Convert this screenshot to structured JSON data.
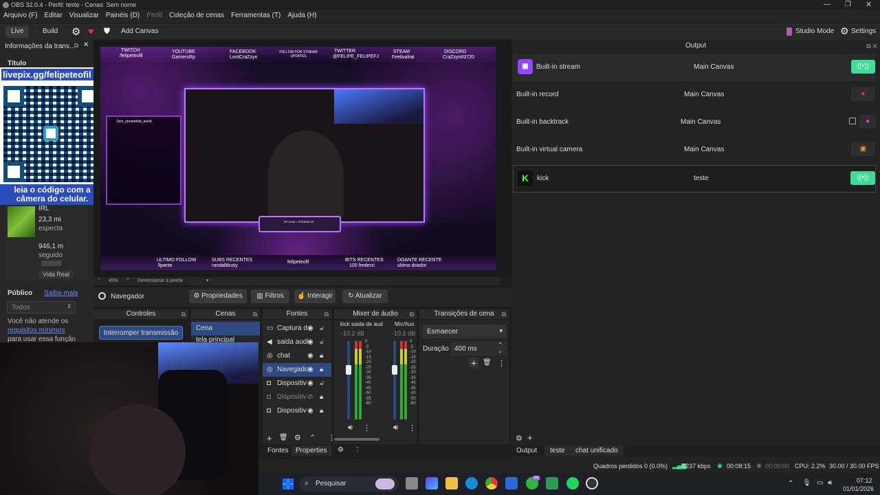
{
  "window": {
    "title": "OBS 32.0.4 - Perfil: teste - Cenas: Sem nome"
  },
  "menu": [
    "Arquivo (F)",
    "Editar",
    "Visualizar",
    "Painéis (D)",
    "Perfil",
    "Coleção de cenas",
    "Ferramentas (T)",
    "Ajuda (H)"
  ],
  "toolbar": {
    "live": "Live",
    "build": "Build",
    "add_canvas": "Add Canvas",
    "studio_mode": "Studio Mode",
    "settings": "Settings"
  },
  "left_dock": {
    "title": "Informações da trans...",
    "titulo": "Título",
    "livepix": "livepix.gg/felipeteofil",
    "qr_caption": "leia o código com a câmera do celular.",
    "category_short": "IRL",
    "viewers": "23,3 mi",
    "viewers_label": "especta",
    "followers": "946,1 m",
    "followers_label": "seguido",
    "vida_real": "Vida Real",
    "publico": "Público",
    "saiba_mais": "Saiba mais",
    "select_value": "Todos",
    "req_text1": "Você não atende os",
    "req_link": "requisitos mínimos",
    "req_text2": "para usar essa função"
  },
  "preview": {
    "zoom": "45%",
    "scale_label": "Dimensionar à janela",
    "overlay_labels": [
      "TWITCH",
      "YOUTUBE",
      "FACEBOOK",
      "TWITTER",
      "STEAM",
      "DISCORD"
    ],
    "overlay_values": [
      "/felipeteofil",
      "GamersRp",
      "LordCraZzyn",
      "@FELIPE_FELIPEFJ",
      "Feelivalrat",
      "CraZzyn#3720"
    ],
    "follow_label": "FOLLOW FOR STREAM UPDATES",
    "bottom_labels": [
      "ULTIMO FOLLOW",
      "SUBS RECENTES",
      "felipeteofil",
      "BITS RECENTES",
      "DOANTE RECENTE"
    ],
    "bottom_values": [
      "llpante",
      "randalldusty",
      "",
      "100   frederzi",
      "ultimo doador"
    ],
    "chat_line": "0cm_streamhab_world",
    "goal_label": "TIP GOAL / STREAM UP"
  },
  "source_toolbar": {
    "name": "Navegador",
    "props": "Propriedades",
    "filters": "Filtros",
    "interact": "Interagir",
    "refresh": "Atualizar"
  },
  "controls": {
    "title": "Controles",
    "stop": "Interromper transmissão"
  },
  "scenes": {
    "title": "Cenas",
    "items": [
      "Cena",
      "tela principal"
    ]
  },
  "sources": {
    "title": "Fontes",
    "items": [
      "Captura d",
      "saida audi",
      "chat",
      "Navegadc",
      "Dispositiv",
      "Dispositiv",
      "Dispositiv"
    ],
    "tab_sources": "Fontes",
    "tab_props": "Properties"
  },
  "mixer": {
    "title": "Mixer de áudio",
    "ch1_name": "kick saida de aud",
    "ch1_db": "-10.2 dB",
    "ch2_name": "Mic/Aux",
    "ch2_db": "-10.1 dB",
    "scale": [
      "0",
      "-5",
      "-10",
      "-15",
      "-20",
      "-25",
      "-30",
      "-35",
      "-40",
      "-45",
      "-50",
      "-55",
      "-60"
    ]
  },
  "transitions": {
    "title": "Transições de cena",
    "selected": "Esmaecer",
    "duration_label": "Duração",
    "duration": "400 ms"
  },
  "output": {
    "title": "Output",
    "rows": [
      {
        "name": "Built-in stream",
        "canvas": "Main Canvas"
      },
      {
        "name": "Built-in record",
        "canvas": "Main Canvas"
      },
      {
        "name": "Built-in backtrack",
        "canvas": "Main Canvas"
      },
      {
        "name": "Built-in virtual camera",
        "canvas": "Main Canvas"
      },
      {
        "name": "kick",
        "canvas": "teste"
      }
    ],
    "tabs": [
      "Output",
      "teste",
      "chat unificado"
    ]
  },
  "status": {
    "dropped": "Quadros perdidos 0 (0.0%)",
    "bitrate": "6237 kbps",
    "stream_time": "00:08:15",
    "rec_time": "00:00:00",
    "cpu": "CPU: 2.2%",
    "fps": "30.00 / 30.00 FPS"
  },
  "taskbar": {
    "search": "Pesquisar",
    "time": "07:12",
    "date": "01/01/2026",
    "badge": "66"
  },
  "colors": {
    "accent_green": "#3ddc97",
    "twitch_purple": "#9146ff",
    "kick_green": "#53fc18"
  }
}
